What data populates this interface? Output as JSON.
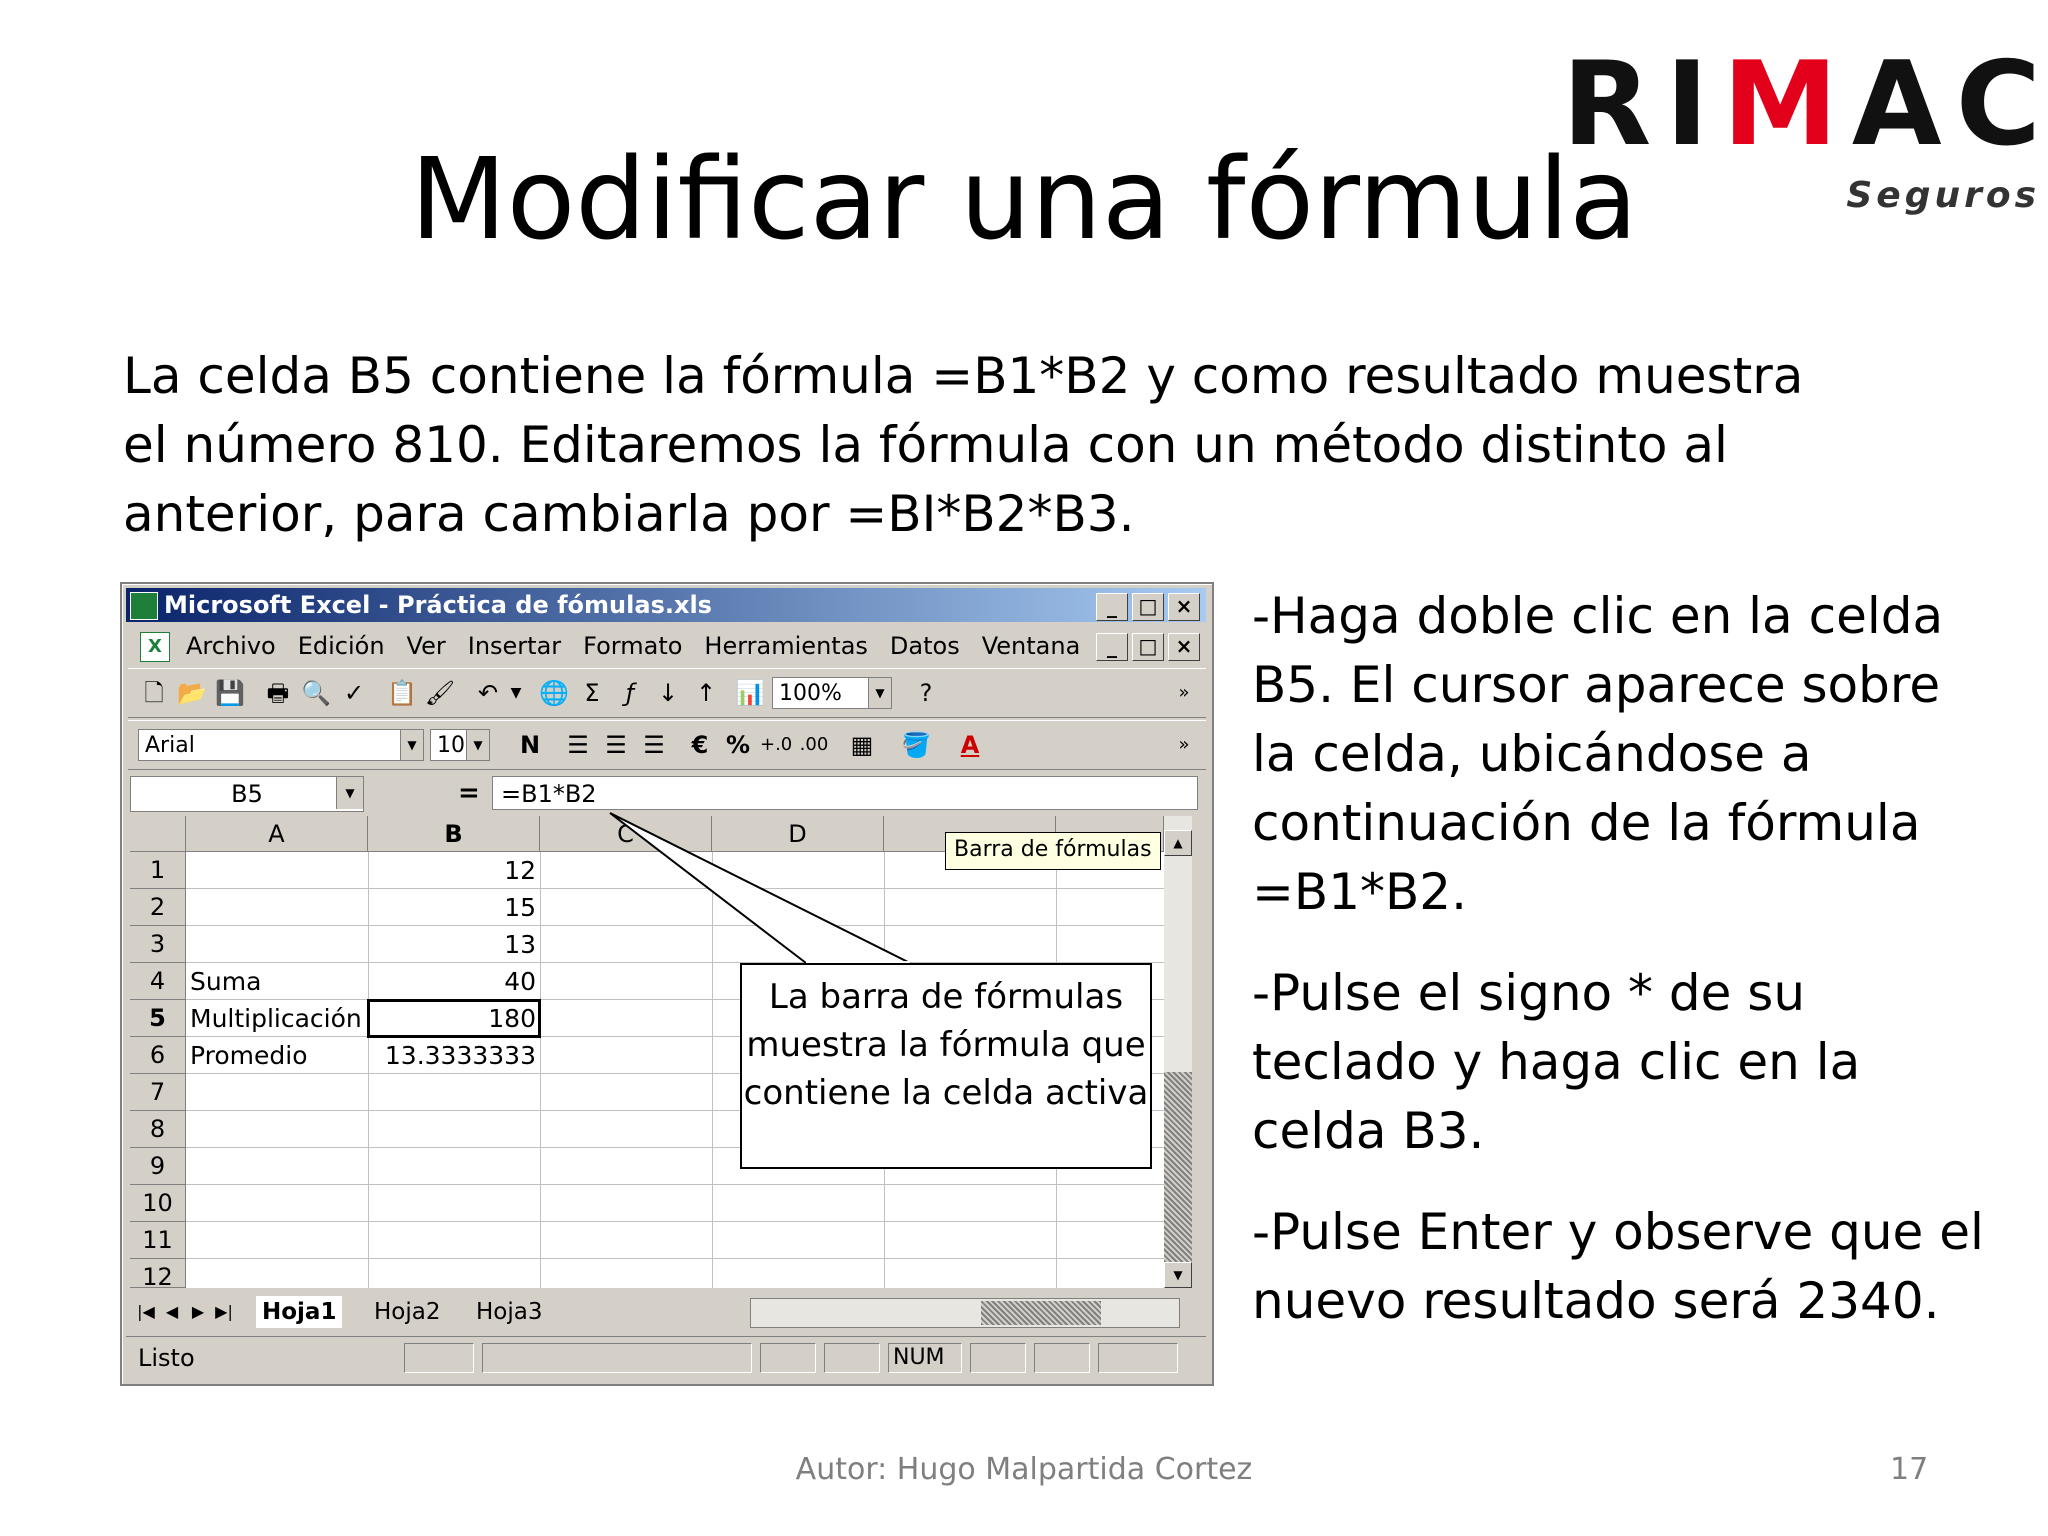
{
  "slide": {
    "title": "Modificar una fórmula",
    "intro": "La celda B5 contiene la fórmula =B1*B2 y como resultado muestra el número 810. Editaremos la fórmula con un método distinto al anterior, para cambiarla por =BI*B2*B3.",
    "steps": [
      "-Haga doble clic en la celda B5. El cursor aparece sobre la celda, ubicándose a continuación de la fórmula =B1*B2.",
      "-Pulse el signo * de su teclado y haga clic en la celda B3.",
      "-Pulse Enter y observe que el nuevo resultado será 2340."
    ],
    "footer_author": "Autor: Hugo Malpartida Cortez",
    "page_number": "17"
  },
  "logo": {
    "word_pre": "RI",
    "word_m": "M",
    "word_post": "AC",
    "sub": "Seguros",
    "accent": "#e3001b"
  },
  "excel": {
    "window_title": "Microsoft Excel - Práctica de fómulas.xls",
    "window_buttons": [
      "_",
      "□",
      "×"
    ],
    "menu": [
      "Archivo",
      "Edición",
      "Ver",
      "Insertar",
      "Formato",
      "Herramientas",
      "Datos",
      "Ventana",
      "?"
    ],
    "zoom": "100%",
    "font": "Arial",
    "font_size": "10",
    "name_box": "B5",
    "equals": "=",
    "formula": "=B1*B2",
    "columns": [
      "A",
      "B",
      "C",
      "D"
    ],
    "rows": [
      "1",
      "2",
      "3",
      "4",
      "5",
      "6",
      "7",
      "8",
      "9",
      "10",
      "11",
      "12"
    ],
    "cells": {
      "B1": "12",
      "B2": "15",
      "B3": "13",
      "A4": "Suma",
      "B4": "40",
      "A5": "Multiplicación",
      "B5": "180",
      "A6": "Promedio",
      "B6": "13.3333333"
    },
    "tooltip": "Barra de fórmulas",
    "sheets": [
      "Hoja1",
      "Hoja2",
      "Hoja3"
    ],
    "status": "Listo",
    "num_indicator": "NUM",
    "callout": "La barra de fórmulas muestra la fórmula que contiene la celda activa"
  }
}
